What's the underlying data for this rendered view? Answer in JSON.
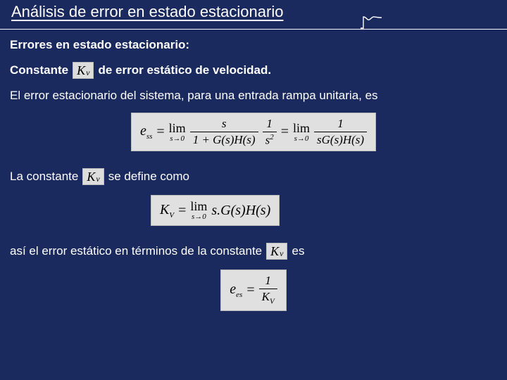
{
  "title": "Análisis de error en estado estacionario",
  "subtitle": "Errores en estado estacionario:",
  "kv_symbol": {
    "base": "K",
    "sub": "ν"
  },
  "line_constante": {
    "before": "Constante",
    "after": "de error estático de velocidad."
  },
  "line_intro": "El error estacionario del sistema, para una entrada rampa unitaria, es",
  "eq1": {
    "lhs_base": "e",
    "lhs_sub": "ss",
    "lim_top": "lim",
    "lim_bot": "s→0",
    "frac1_num": "s",
    "frac1_den": "1 + G(s)H(s)",
    "frac2_num": "1",
    "frac2_den_base": "s",
    "frac2_den_sup": "2",
    "frac3_num": "1",
    "frac3_den": "sG(s)H(s)"
  },
  "line_define": {
    "before": "La constante",
    "after": "se define como"
  },
  "eq2": {
    "lhs_base": "K",
    "lhs_sub": "V",
    "lim_top": "lim",
    "lim_bot": "s→0",
    "rhs": "s.G(s)H(s)"
  },
  "line_final": {
    "before": "así el error estático en términos de la constante",
    "after": "es"
  },
  "eq3": {
    "lhs_base": "e",
    "lhs_sub": "es",
    "frac_num": "1",
    "frac_den_base": "K",
    "frac_den_sub": "V"
  }
}
